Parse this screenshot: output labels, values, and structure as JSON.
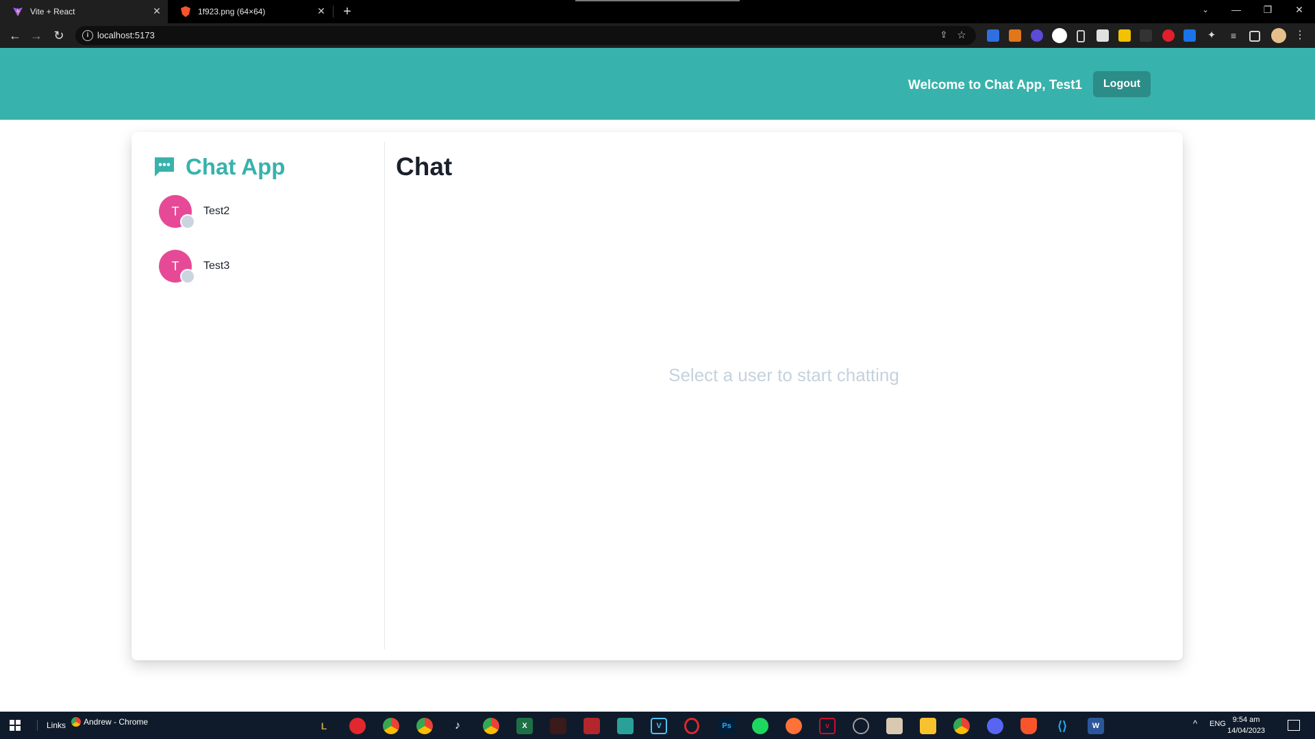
{
  "browser": {
    "tabs": [
      {
        "title": "Vite + React",
        "icon": "vite-logo-icon"
      },
      {
        "title": "1f923.png (64×64)",
        "icon": "brave-shield-icon"
      }
    ],
    "url": "localhost:5173"
  },
  "header": {
    "welcome": "Welcome to Chat App, Test1",
    "logout_label": "Logout"
  },
  "sidebar": {
    "brand": "Chat App",
    "users": [
      {
        "initial": "T",
        "name": "Test2"
      },
      {
        "initial": "T",
        "name": "Test3"
      }
    ]
  },
  "main": {
    "title": "Chat",
    "empty_message": "Select a user to start chatting"
  },
  "taskbar": {
    "links_label": "Links",
    "window_label": "Andrew - Chrome",
    "language": "ENG",
    "time": "9:54 am",
    "date": "14/04/2023"
  },
  "colors": {
    "accent": "#38b2ac",
    "avatar": "#e64a97",
    "status_offline": "#cbd5e0"
  }
}
